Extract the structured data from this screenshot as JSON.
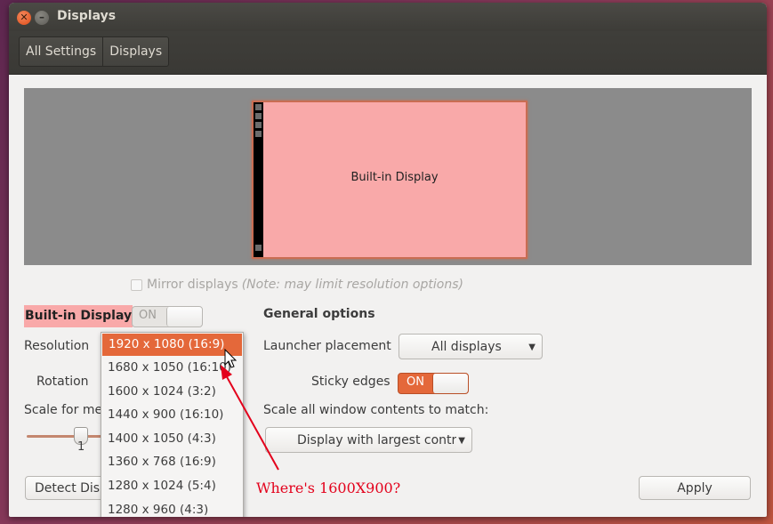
{
  "window": {
    "title": "Displays"
  },
  "breadcrumbs": [
    "All Settings",
    "Displays"
  ],
  "preview": {
    "display_name": "Built-in Display"
  },
  "mirror": {
    "label": "Mirror displays",
    "note": "(Note: may limit resolution options)"
  },
  "display_settings": {
    "name": "Built-in Display",
    "toggle": "ON",
    "resolution_label": "Resolution",
    "rotation_label": "Rotation",
    "scale_label": "Scale for menu and title bars:",
    "scale_value": "1",
    "detect_button": "Detect Displays"
  },
  "resolution_options": [
    "1920 x 1080 (16:9)",
    "1680 x 1050 (16:10)",
    "1600 x 1024 (3:2)",
    "1440 x 900 (16:10)",
    "1400 x 1050 (4:3)",
    "1360 x 768 (16:9)",
    "1280 x 1024 (5:4)",
    "1280 x 960 (4:3)"
  ],
  "general": {
    "heading": "General options",
    "launcher_label": "Launcher placement",
    "launcher_value": "All displays",
    "sticky_label": "Sticky edges",
    "sticky_toggle": "ON",
    "scale_all_label": "Scale all window contents to match:",
    "scale_all_value": "Display with largest contr"
  },
  "apply_button": "Apply",
  "annotation": {
    "text": "Where's 1600X900?",
    "color": "#e3001b"
  },
  "colors": {
    "accent": "#e4683a",
    "highlight": "#f9a9a9"
  }
}
